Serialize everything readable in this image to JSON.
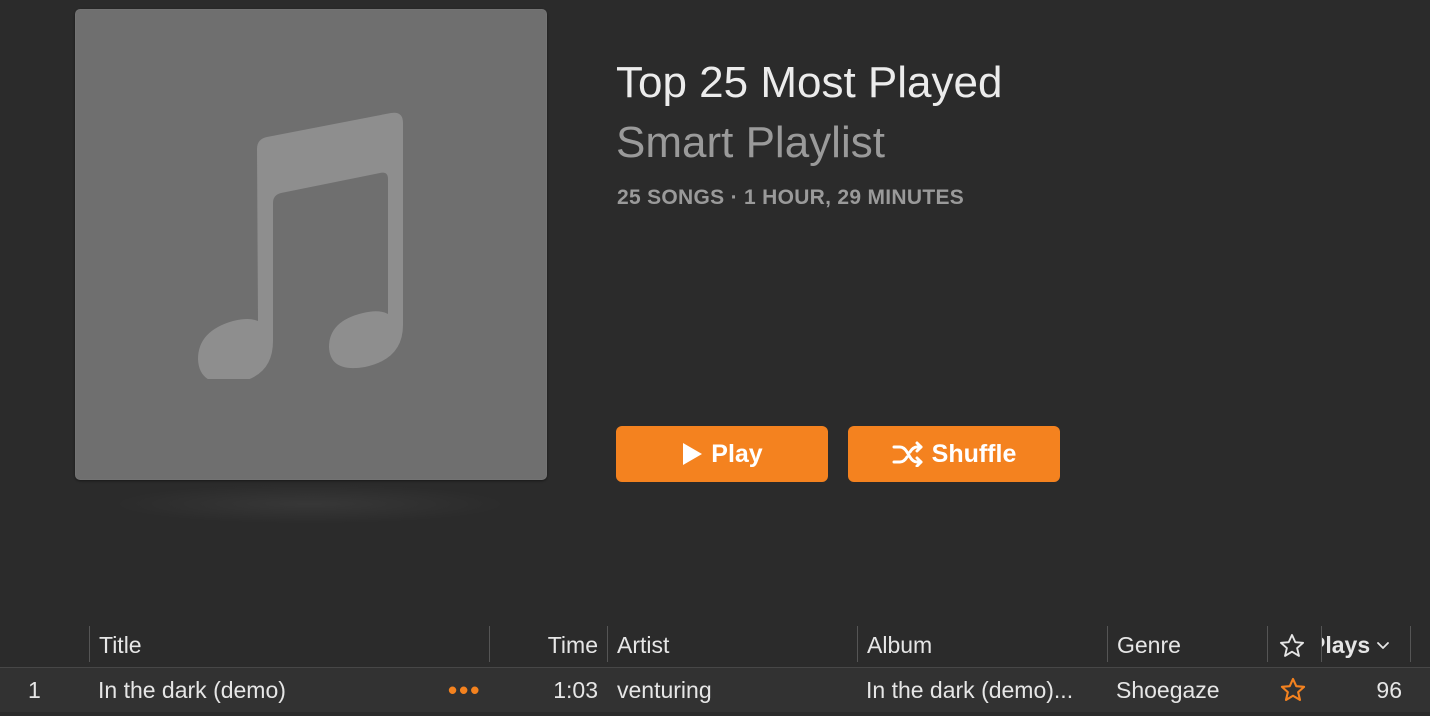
{
  "playlist": {
    "title": "Top 25 Most Played",
    "subtitle": "Smart Playlist",
    "meta": "25 SONGS · 1 HOUR, 29 MINUTES",
    "artwork_icon": "music-note-icon"
  },
  "buttons": {
    "play_label": "Play",
    "shuffle_label": "Shuffle",
    "accent_color": "#f4821f"
  },
  "table": {
    "columns": {
      "title": "Title",
      "time": "Time",
      "artist": "Artist",
      "album": "Album",
      "genre": "Genre",
      "rating_icon": "star-icon",
      "plays": "Plays"
    },
    "rows": [
      {
        "index": "1",
        "title": "In the dark (demo)",
        "more": "•••",
        "time": "1:03",
        "artist": "venturing",
        "album": "In the dark (demo)...",
        "genre": "Shoegaze",
        "rating": "☆",
        "plays": "96"
      }
    ]
  }
}
